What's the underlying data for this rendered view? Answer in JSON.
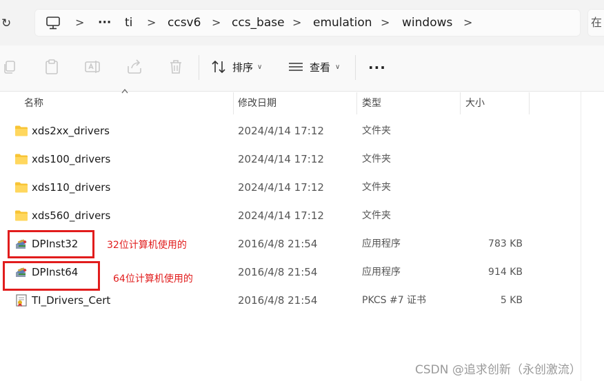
{
  "breadcrumb": {
    "items": [
      "ti",
      "ccsv6",
      "ccs_base",
      "emulation",
      "windows"
    ],
    "overflow": "···",
    "separator": ">"
  },
  "search": {
    "cut_off_char": "在"
  },
  "toolbar": {
    "sort_label": "排序",
    "view_label": "查看",
    "more_label": "···"
  },
  "columns": {
    "name": "名称",
    "modified": "修改日期",
    "type": "类型",
    "size": "大小"
  },
  "files": [
    {
      "name": "xds2xx_drivers",
      "modified": "2024/4/14 17:12",
      "type": "文件夹",
      "size": "",
      "icon": "folder-icon"
    },
    {
      "name": "xds100_drivers",
      "modified": "2024/4/14 17:12",
      "type": "文件夹",
      "size": "",
      "icon": "folder-icon"
    },
    {
      "name": "xds110_drivers",
      "modified": "2024/4/14 17:12",
      "type": "文件夹",
      "size": "",
      "icon": "folder-icon"
    },
    {
      "name": "xds560_drivers",
      "modified": "2024/4/14 17:12",
      "type": "文件夹",
      "size": "",
      "icon": "folder-icon"
    },
    {
      "name": "DPInst32",
      "modified": "2016/4/8 21:54",
      "type": "应用程序",
      "size": "783 KB",
      "icon": "installer-icon"
    },
    {
      "name": "DPInst64",
      "modified": "2016/4/8 21:54",
      "type": "应用程序",
      "size": "914 KB",
      "icon": "installer-icon"
    },
    {
      "name": "TI_Drivers_Cert",
      "modified": "2016/4/8 21:54",
      "type": "PKCS #7 证书",
      "size": "5 KB",
      "icon": "certificate-icon"
    }
  ],
  "annotations": [
    {
      "text": "32位计算机使用的"
    },
    {
      "text": "64位计算机使用的"
    }
  ],
  "watermark": "CSDN @追求创新（永创激流）",
  "colors": {
    "annotation_red": "#e11c1c",
    "folder_yellow": "#f8c435"
  }
}
